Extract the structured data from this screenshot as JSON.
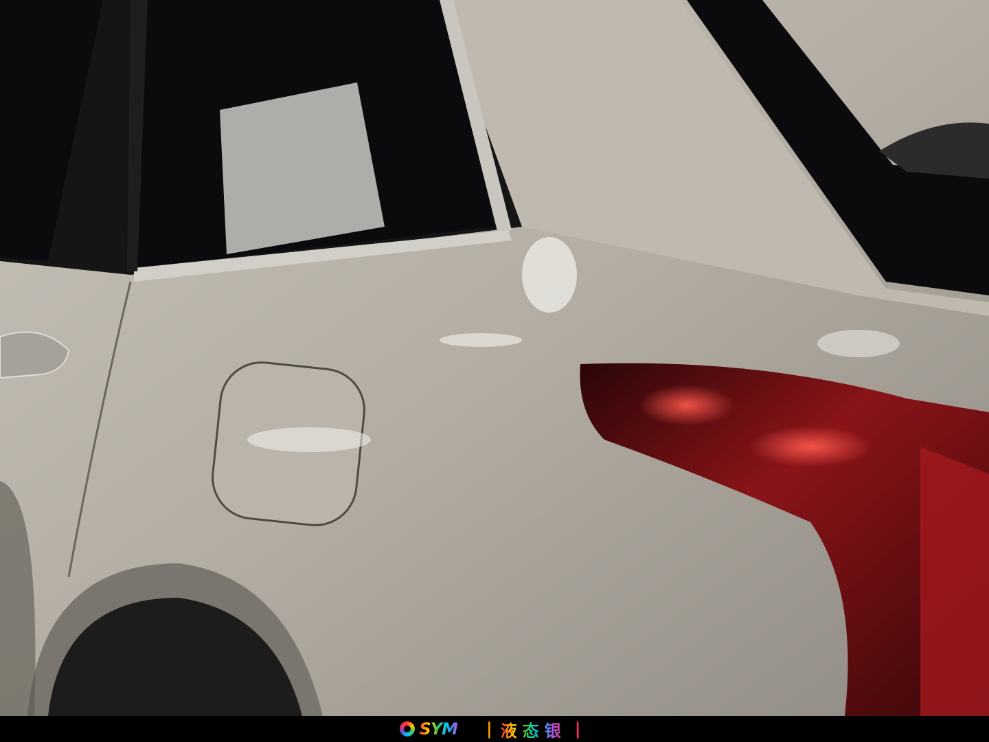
{
  "photo": {
    "subject": "",
    "colors": {
      "body": "#b8b2a8",
      "body_shadow": "#6e6a63",
      "glass": "#0b0b0d",
      "trim": "#c9c6c0",
      "taillight": "#8a1418",
      "taillight_glow": "#e2383a",
      "tire": "#1c1c1c"
    }
  },
  "caption": {
    "brand": "SYM",
    "separator_left": "|",
    "title": "液态银",
    "separator_right": "|"
  }
}
